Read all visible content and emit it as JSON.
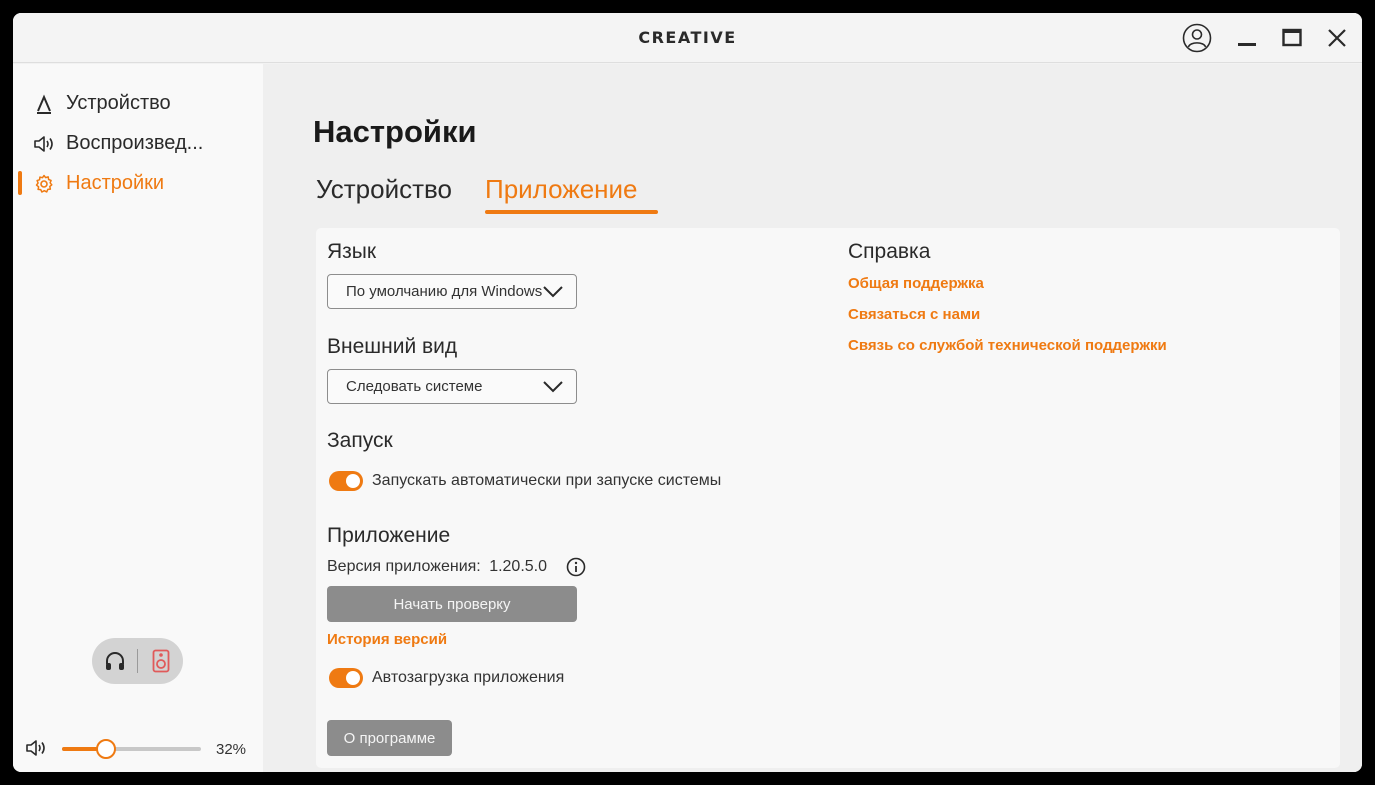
{
  "window": {
    "brand": "CREATIVE"
  },
  "sidebar": {
    "items": [
      {
        "label": "Устройство",
        "icon": "device-icon",
        "active": false
      },
      {
        "label": "Воспроизвед...",
        "icon": "speaker-icon",
        "active": false
      },
      {
        "label": "Настройки",
        "icon": "gear-icon",
        "active": true
      }
    ],
    "output_toggle": {
      "options": [
        "headphones-icon",
        "speaker-device-icon"
      ],
      "selected": "speaker-device-icon"
    },
    "volume": {
      "value": 32,
      "label": "32%"
    }
  },
  "main": {
    "title": "Настройки",
    "tabs": [
      {
        "label": "Устройство",
        "active": false
      },
      {
        "label": "Приложение",
        "active": true
      }
    ],
    "language": {
      "label": "Язык",
      "selected": "По умолчанию для Windows"
    },
    "appearance": {
      "label": "Внешний вид",
      "selected": "Следовать системе"
    },
    "startup": {
      "label": "Запуск",
      "toggle_label": "Запускать автоматически при запуске системы",
      "enabled": true
    },
    "application": {
      "label": "Приложение",
      "version_label": "Версия приложения:",
      "version": "1.20.5.0",
      "check_button": "Начать проверку",
      "history_link": "История версий",
      "autoupdate_label": "Автозагрузка приложения",
      "autoupdate_enabled": true,
      "about_button": "О программе"
    },
    "help": {
      "label": "Справка",
      "links": [
        "Общая поддержка",
        "Связаться с нами",
        "Связь со службой технической поддержки"
      ]
    }
  },
  "colors": {
    "accent": "#ef7a12",
    "button_grey": "#8c8c8c"
  }
}
